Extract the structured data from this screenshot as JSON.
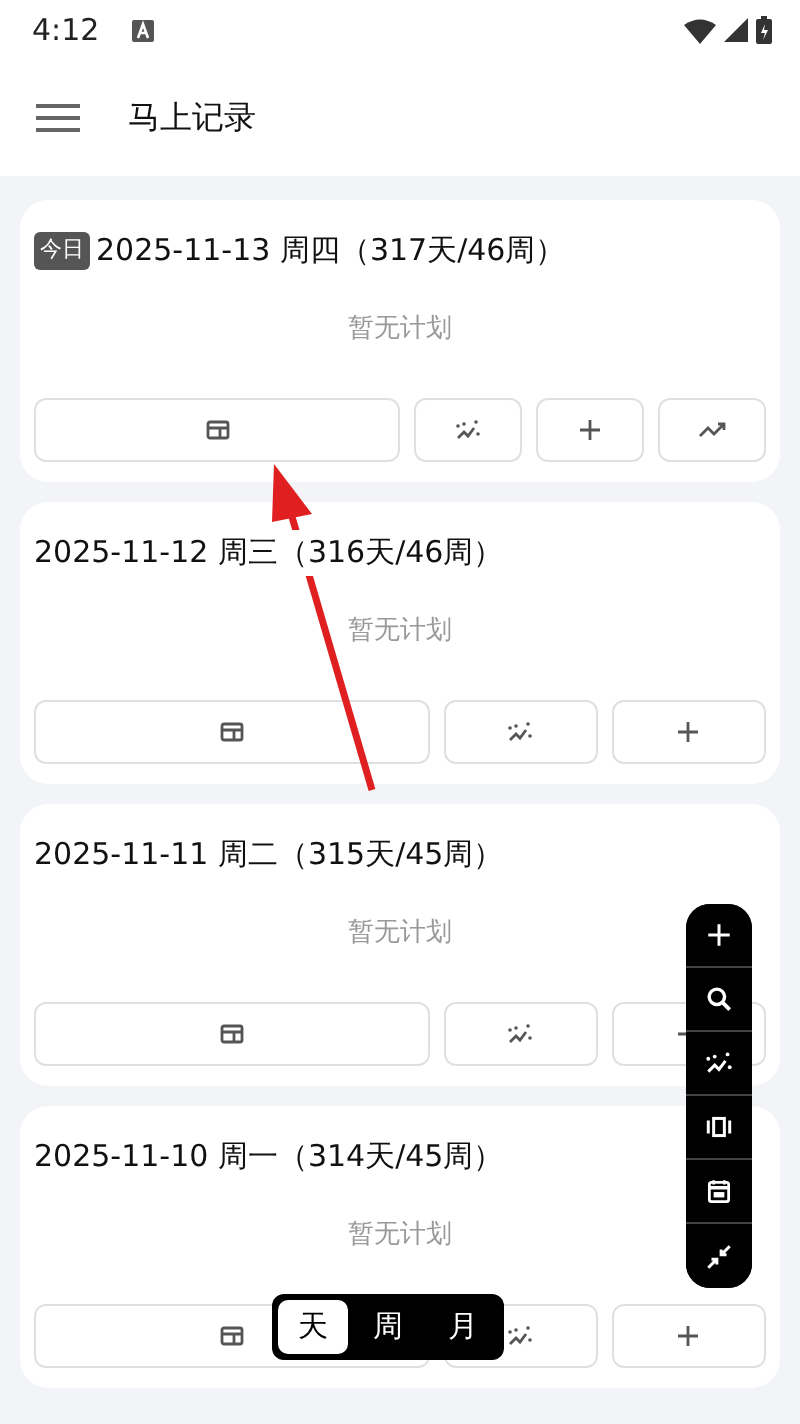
{
  "status_bar": {
    "time": "4:12"
  },
  "app_bar": {
    "title": "马上记录"
  },
  "days": [
    {
      "today_badge": "今日",
      "date": "2025-11-13 周四（317天/46周）",
      "empty_text": "暂无计划",
      "actions": [
        {
          "kind": "note"
        },
        {
          "kind": "stats"
        },
        {
          "kind": "add"
        },
        {
          "kind": "trend"
        }
      ]
    },
    {
      "date": "2025-11-12 周三（316天/46周）",
      "empty_text": "暂无计划",
      "actions": [
        {
          "kind": "note"
        },
        {
          "kind": "stats"
        },
        {
          "kind": "add"
        }
      ]
    },
    {
      "date": "2025-11-11 周二（315天/45周）",
      "empty_text": "暂无计划",
      "actions": [
        {
          "kind": "note"
        },
        {
          "kind": "stats"
        },
        {
          "kind": "add"
        }
      ]
    },
    {
      "date": "2025-11-10 周一（314天/45周）",
      "empty_text": "暂无计划",
      "actions": [
        {
          "kind": "note"
        },
        {
          "kind": "stats"
        },
        {
          "kind": "add"
        }
      ]
    }
  ],
  "fab_toolbar": [
    {
      "kind": "add"
    },
    {
      "kind": "search"
    },
    {
      "kind": "stats"
    },
    {
      "kind": "carousel"
    },
    {
      "kind": "calendar"
    },
    {
      "kind": "collapse"
    }
  ],
  "view_switch": [
    {
      "label": "天",
      "selected": true
    },
    {
      "label": "周",
      "selected": false
    },
    {
      "label": "月",
      "selected": false
    }
  ]
}
